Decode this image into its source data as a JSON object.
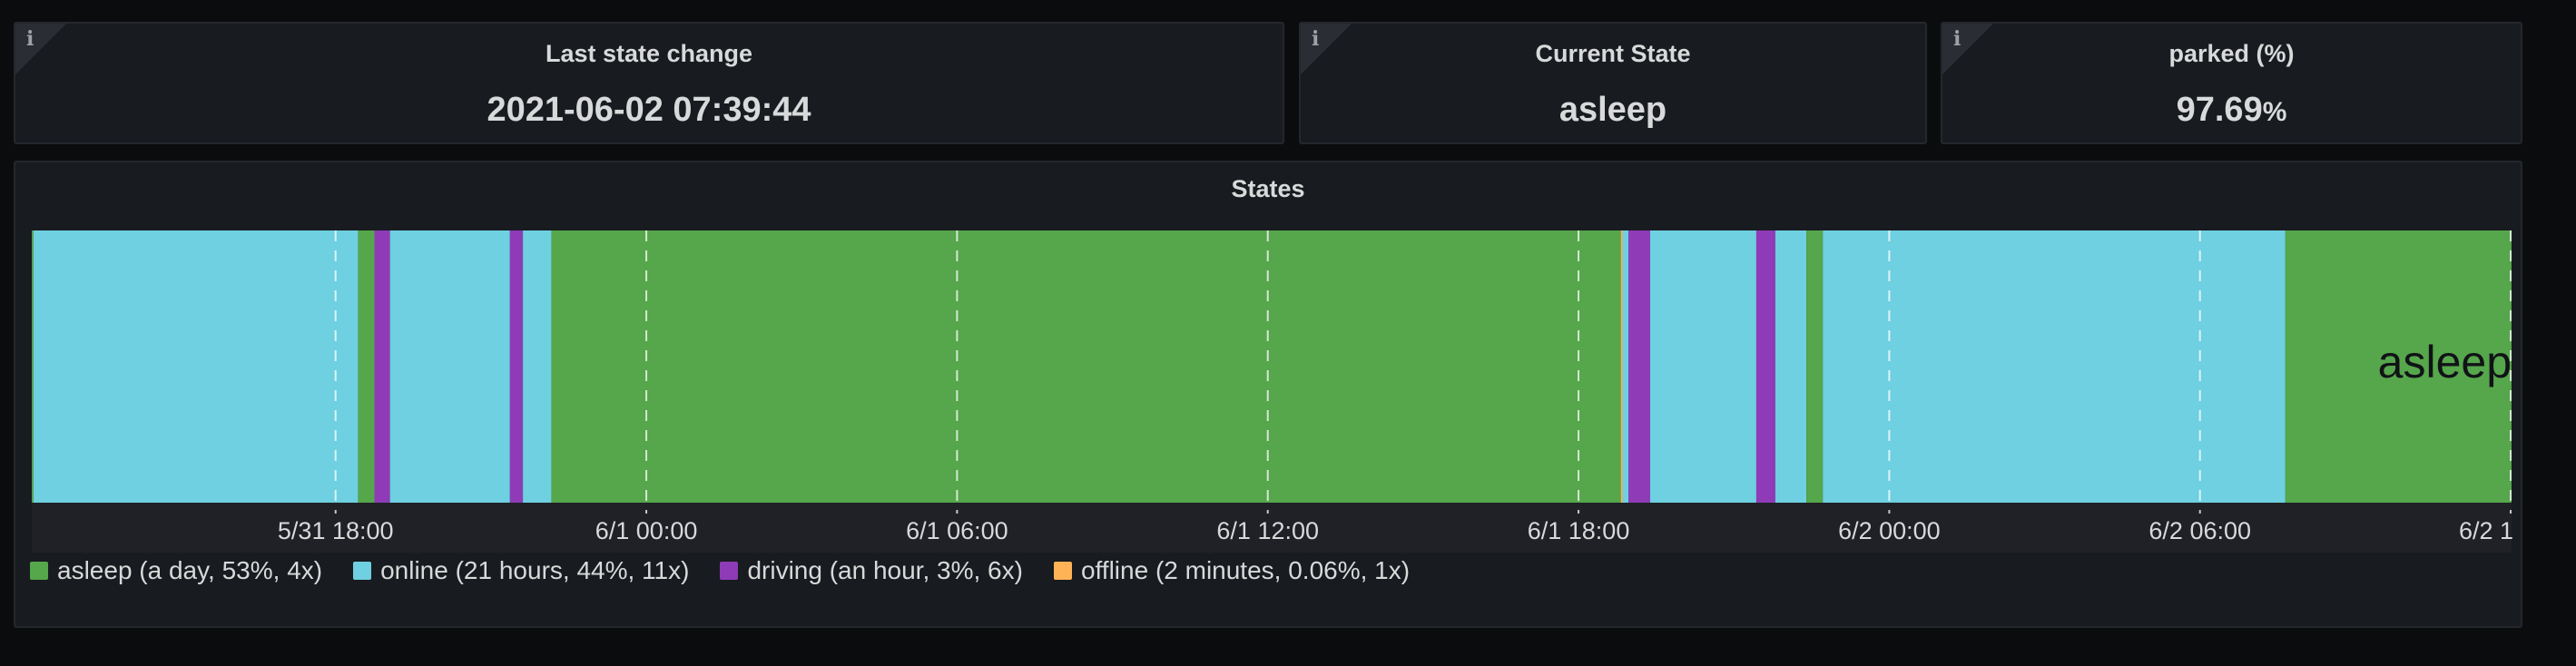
{
  "stats": [
    {
      "title": "Last state change",
      "value": "2021-06-02 07:39:44",
      "unit": ""
    },
    {
      "title": "Current State",
      "value": "asleep",
      "unit": ""
    },
    {
      "title": "parked (%)",
      "value": "97.69",
      "unit": "%"
    }
  ],
  "states_panel": {
    "title": "States",
    "current_label": "asleep"
  },
  "colors": {
    "asleep": "#56a64b",
    "online": "#6ed0e0",
    "driving": "#8f3bb8",
    "offline": "#ffb357",
    "panel_bg": "#181b1f"
  },
  "chart_data": {
    "type": "state-timeline",
    "title": "States",
    "x_range": [
      "2021-05-31 12:08",
      "2021-06-02 12:01"
    ],
    "x_ticks": [
      "5/31 18:00",
      "6/1 00:00",
      "6/1 06:00",
      "6/1 12:00",
      "6/1 18:00",
      "6/2 00:00",
      "6/2 06:00",
      "6/2 1"
    ],
    "segments": [
      {
        "state": "asleep",
        "start": "2021-05-31 12:08",
        "end": "2021-05-31 12:10"
      },
      {
        "state": "online",
        "start": "2021-05-31 12:10",
        "end": "2021-05-31 18:26"
      },
      {
        "state": "asleep",
        "start": "2021-05-31 18:26",
        "end": "2021-05-31 18:45"
      },
      {
        "state": "driving",
        "start": "2021-05-31 18:45",
        "end": "2021-05-31 19:03"
      },
      {
        "state": "online",
        "start": "2021-05-31 19:03",
        "end": "2021-05-31 21:22"
      },
      {
        "state": "driving",
        "start": "2021-05-31 21:22",
        "end": "2021-05-31 21:37"
      },
      {
        "state": "online",
        "start": "2021-05-31 21:37",
        "end": "2021-05-31 22:10"
      },
      {
        "state": "asleep",
        "start": "2021-05-31 22:10",
        "end": "2021-06-01 18:49"
      },
      {
        "state": "offline",
        "start": "2021-06-01 18:49",
        "end": "2021-06-01 18:51"
      },
      {
        "state": "online",
        "start": "2021-06-01 18:51",
        "end": "2021-06-01 18:58"
      },
      {
        "state": "driving",
        "start": "2021-06-01 18:58",
        "end": "2021-06-01 19:23"
      },
      {
        "state": "online",
        "start": "2021-06-01 19:23",
        "end": "2021-06-01 21:26"
      },
      {
        "state": "driving",
        "start": "2021-06-01 21:26",
        "end": "2021-06-01 21:48"
      },
      {
        "state": "online",
        "start": "2021-06-01 21:48",
        "end": "2021-06-01 22:24"
      },
      {
        "state": "asleep",
        "start": "2021-06-01 22:24",
        "end": "2021-06-01 22:43"
      },
      {
        "state": "online",
        "start": "2021-06-01 22:43",
        "end": "2021-06-02 07:39"
      },
      {
        "state": "asleep",
        "start": "2021-06-02 07:39",
        "end": "2021-06-02 12:01"
      }
    ],
    "legend": [
      {
        "state": "asleep",
        "label": "asleep (a day, 53%, 4x)"
      },
      {
        "state": "online",
        "label": "online (21 hours, 44%, 11x)"
      },
      {
        "state": "driving",
        "label": "driving (an hour, 3%, 6x)"
      },
      {
        "state": "offline",
        "label": "offline (2 minutes, 0.06%, 1x)"
      }
    ],
    "grid": true,
    "legend_position": "bottom-left"
  }
}
